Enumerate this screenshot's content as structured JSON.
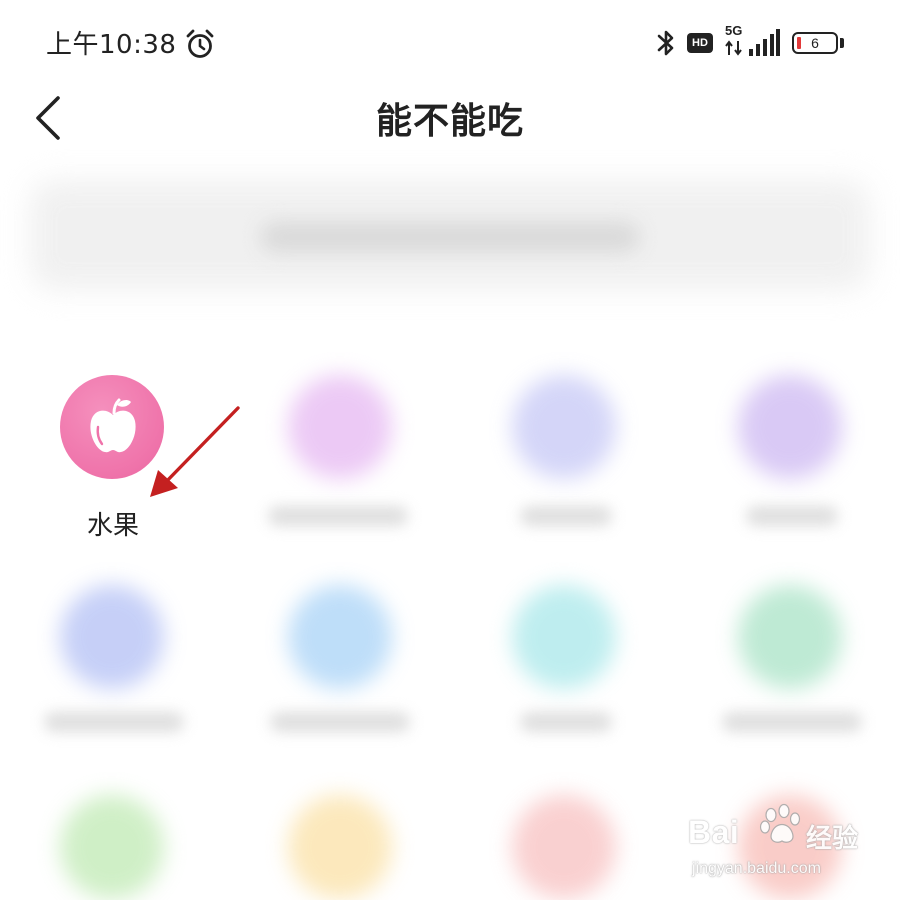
{
  "status_bar": {
    "time": "上午10:38",
    "hd_label": "HD",
    "network_label": "5G",
    "battery_level": "6"
  },
  "header": {
    "title": "能不能吃"
  },
  "categories": [
    {
      "label": "水果",
      "icon": "apple-icon",
      "color": "#ef73aa"
    }
  ],
  "blurred_category_colors": [
    "#e6b8f2",
    "#c6c8f6",
    "#cdb8f2",
    "#b3c0f5",
    "#a9d3f7",
    "#a9e8ea",
    "#a9e3c6",
    "#c0eab4",
    "#fbe1a6",
    "#f8c1c1",
    "#f8bcb6"
  ],
  "watermark": {
    "logo": "Bai",
    "logo_suffix": "经验",
    "url": "jingyan.baidu.com"
  }
}
